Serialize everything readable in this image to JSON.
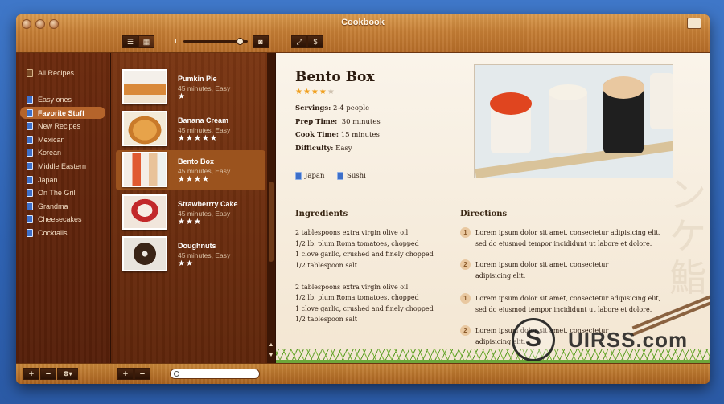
{
  "window": {
    "title": "Cookbook"
  },
  "sidebar": {
    "items": [
      {
        "label": "All Recipes",
        "icon": "book-icon"
      },
      {
        "label": "Easy ones",
        "icon": "collection-icon"
      },
      {
        "label": "Favorite Stuff",
        "icon": "collection-icon",
        "selected": true
      },
      {
        "label": "New Recipes",
        "icon": "collection-icon"
      },
      {
        "label": "Mexican",
        "icon": "collection-icon"
      },
      {
        "label": "Korean",
        "icon": "collection-icon"
      },
      {
        "label": "Middle Eastern",
        "icon": "collection-icon"
      },
      {
        "label": "Japan",
        "icon": "collection-icon"
      },
      {
        "label": "On The Grill",
        "icon": "collection-icon"
      },
      {
        "label": "Grandma",
        "icon": "collection-icon"
      },
      {
        "label": "Cheesecakes",
        "icon": "collection-icon"
      },
      {
        "label": "Cocktails",
        "icon": "collection-icon"
      }
    ]
  },
  "recipes": [
    {
      "name": "Pumkin Pie",
      "meta": "45 minutes, Easy",
      "stars": "★",
      "rating": 1
    },
    {
      "name": "Banana Cream",
      "meta": "45 minutes, Easy",
      "stars": "★★★★★",
      "rating": 5
    },
    {
      "name": "Bento Box",
      "meta": "45 minutes, Easy",
      "stars": "★★★★",
      "rating": 4,
      "selected": true
    },
    {
      "name": "Strawberrry Cake",
      "meta": "45 minutes, Easy",
      "stars": "★★★",
      "rating": 3
    },
    {
      "name": "Doughnuts",
      "meta": "45 minutes, Easy",
      "stars": "★★",
      "rating": 2
    }
  ],
  "detail": {
    "title": "Bento Box",
    "rating": {
      "on": "★★★★",
      "off": "★",
      "value": 4,
      "max": 5
    },
    "servings_label": "Servings:",
    "servings": "2-4 people",
    "prep_label": "Prep Time:",
    "prep": "30 minutes",
    "cook_label": "Cook Time:",
    "cook": "15 minutes",
    "difficulty_label": "Difficulty:",
    "difficulty": "Easy",
    "tags": [
      "Japan",
      "Sushi"
    ],
    "ingredients_heading": "Ingredients",
    "ingredients": [
      "2 tablespoons extra virgin olive oil",
      "1/2 lb. plum Roma tomatoes, chopped",
      "1 clove garlic, crushed and finely chopped",
      "1/2 tablespoon salt",
      "2 tablespoons extra virgin olive oil",
      "1/2 lb. plum Roma tomatoes, chopped",
      "1 clove garlic, crushed and finely chopped",
      "1/2 tablespoon salt"
    ],
    "directions_heading": "Directions",
    "directions": [
      {
        "num": "1",
        "line1": "Lorem ipsum dolor sit amet, consectetur adipisicing elit,",
        "line2": "sed do eiusmod tempor incididunt ut labore et dolore."
      },
      {
        "num": "2",
        "line1": "Lorem ipsum dolor sit amet, consectetur",
        "line2": "adipisicing elit."
      },
      {
        "num": "1",
        "line1": "Lorem ipsum dolor sit amet, consectetur adipisicing elit,",
        "line2": "sed do eiusmod tempor incididunt ut labore et dolore."
      },
      {
        "num": "2",
        "line1": "Lorem ipsum dolor sit amet, consectetur",
        "line2": "adipisicing elit."
      }
    ]
  },
  "toolbar": {
    "dollar": "$"
  },
  "bottombar": {
    "plus": "+",
    "minus": "−",
    "gear": "⚙▾"
  },
  "watermark": {
    "text": "UIRSS.com",
    "glyph": "S"
  },
  "colors": {
    "accent": "#b5642b",
    "star": "#f0a020",
    "wood": "#c57e35"
  }
}
